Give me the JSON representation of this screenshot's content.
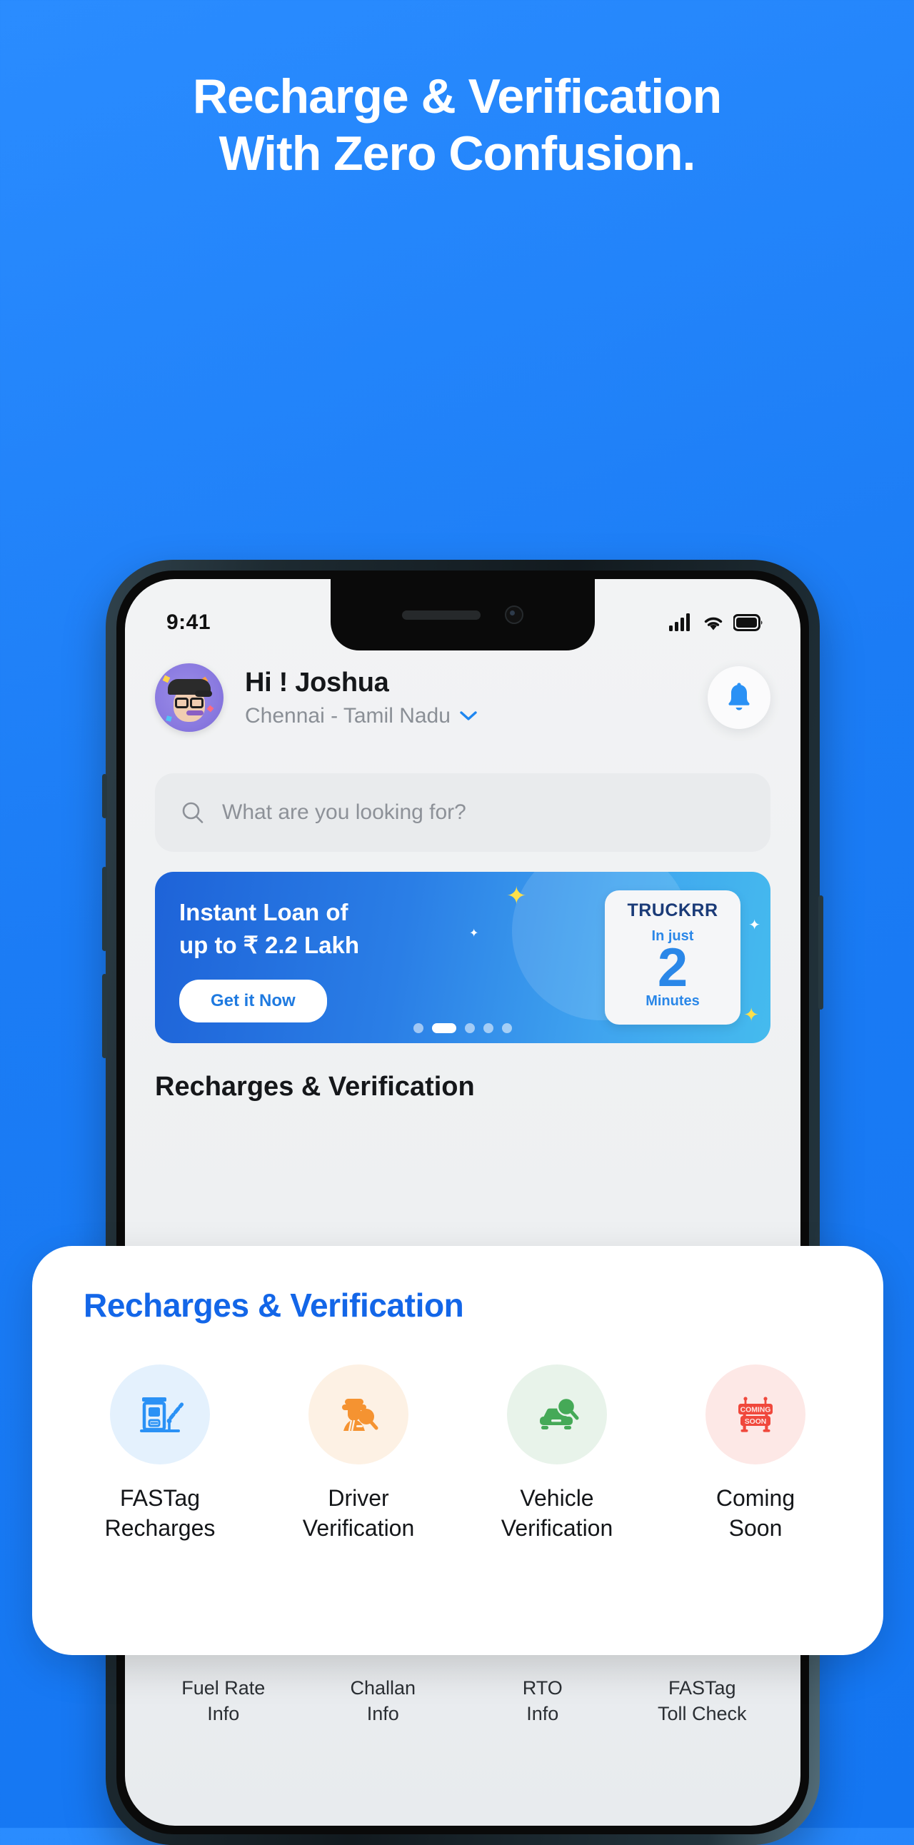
{
  "hero": {
    "line1": "Recharge &  Verification",
    "line2": "With Zero Confusion."
  },
  "phone": {
    "status": {
      "time": "9:41",
      "signal_icon": "cellular-signal-icon",
      "wifi_icon": "wifi-icon",
      "battery_icon": "battery-icon"
    },
    "header": {
      "greeting": "Hi ! Joshua",
      "location": "Chennai - Tamil Nadu",
      "location_chevron_icon": "chevron-down-icon",
      "avatar_icon": "avatar",
      "bell_icon": "bell-icon",
      "bell_color": "#2a91f5"
    },
    "search": {
      "placeholder": "What are you looking for?",
      "icon": "search-icon"
    },
    "banner": {
      "title_line1": "Instant Loan of",
      "title_line2": "up to ₹ 2.2 Lakh",
      "cta": "Get it Now",
      "brand": "TRUCKRR",
      "in_just": "In just",
      "number": "2",
      "minutes": "Minutes",
      "dots_total": 5,
      "dots_active_index": 1,
      "gradient_from": "#1e63d8",
      "gradient_to": "#45bbee"
    },
    "section_heading": "Recharges & Verification",
    "quick_links": [
      {
        "line1": "Fuel Rate",
        "line2": "Info"
      },
      {
        "line1": "Challan",
        "line2": "Info"
      },
      {
        "line1": "RTO",
        "line2": "Info"
      },
      {
        "line1": "FASTag",
        "line2": "Toll Check"
      }
    ]
  },
  "overlay_card": {
    "title": "Recharges & Verification",
    "title_color": "#1366e8",
    "services": [
      {
        "label_line1": "FASTag",
        "label_line2": "Recharges",
        "icon": "toll-booth-icon",
        "icon_color": "#2a91f5",
        "circle_color": "#e4f1fd"
      },
      {
        "label_line1": "Driver",
        "label_line2": "Verification",
        "icon": "driver-search-icon",
        "icon_color": "#f59331",
        "circle_color": "#fdf1e4"
      },
      {
        "label_line1": "Vehicle",
        "label_line2": "Verification",
        "icon": "car-search-icon",
        "icon_color": "#45a957",
        "circle_color": "#e8f3ea"
      },
      {
        "label_line1": "Coming",
        "label_line2": "Soon",
        "icon": "coming-soon-sign-icon",
        "icon_color": "#f0483c",
        "circle_color": "#fde8e6",
        "sign_text_top": "COMING",
        "sign_text_bottom": "SOON"
      }
    ]
  }
}
